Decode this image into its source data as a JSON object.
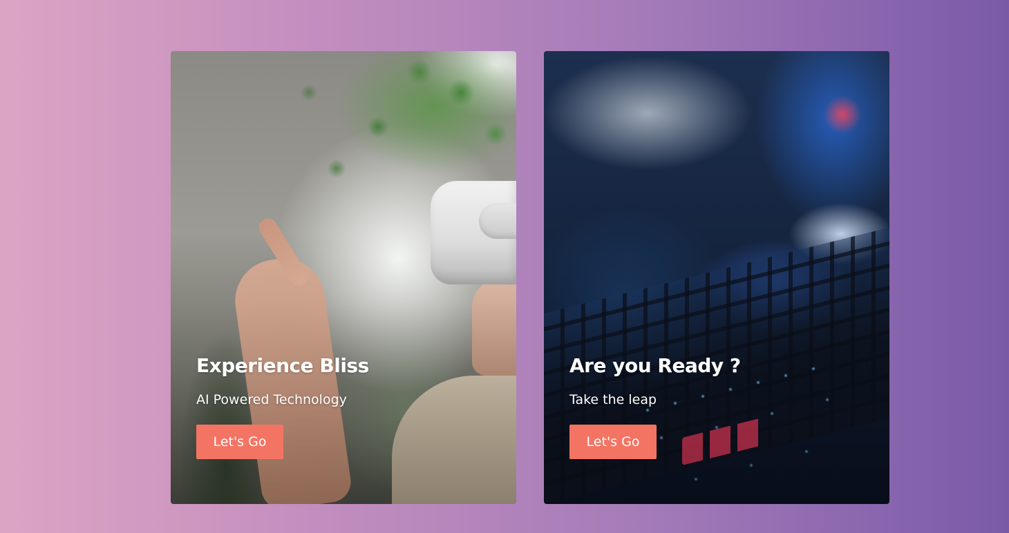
{
  "cards": [
    {
      "title": "Experience Bliss",
      "subtitle": "AI Powered Technology",
      "button_label": "Let's Go",
      "image_subject": "person-wearing-vr-headset"
    },
    {
      "title": "Are you Ready ?",
      "subtitle": "Take the leap",
      "button_label": "Let's Go",
      "image_subject": "backlit-gaming-keyboard"
    }
  ],
  "colors": {
    "background_gradient_start": "#dca4c4",
    "background_gradient_end": "#7a5aa8",
    "button": "#f47464",
    "text": "#ffffff"
  }
}
